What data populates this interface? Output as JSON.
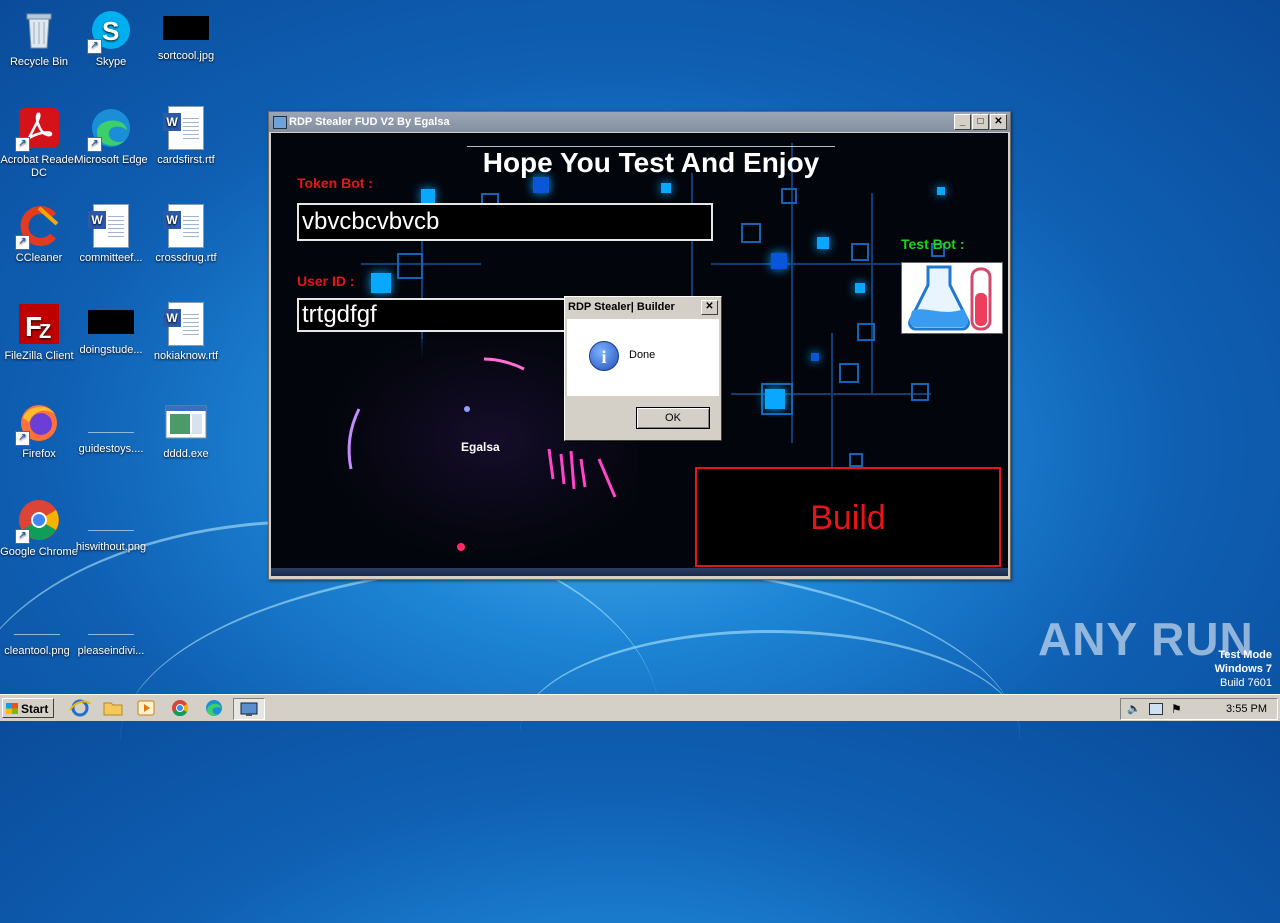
{
  "desktop": {
    "icons": [
      {
        "label": "Recycle Bin"
      },
      {
        "label": "Skype"
      },
      {
        "label": "sortcool.jpg"
      },
      {
        "label": "Acrobat Reader DC"
      },
      {
        "label": "Microsoft Edge"
      },
      {
        "label": "cardsfirst.rtf"
      },
      {
        "label": "CCleaner"
      },
      {
        "label": "committeef..."
      },
      {
        "label": "crossdrug.rtf"
      },
      {
        "label": "FileZilla Client"
      },
      {
        "label": "doingstude..."
      },
      {
        "label": "nokiaknow.rtf"
      },
      {
        "label": "Firefox"
      },
      {
        "label": "guidestoys...."
      },
      {
        "label": "dddd.exe"
      },
      {
        "label": "Google Chrome"
      },
      {
        "label": "hiswithout.png"
      },
      {
        "label": "cleantool.png"
      },
      {
        "label": "pleaseindivi..."
      }
    ]
  },
  "window": {
    "title": "RDP Stealer FUD V2 By Egalsa",
    "headline": "Hope You Test And Enjoy",
    "token_label": "Token Bot :",
    "token_value": "vbvcbcvbvcb",
    "userid_label": "User ID :",
    "userid_value": "trtgdfgf",
    "testbot_label": "Test Bot :",
    "author_text": "Egalsa",
    "build_label": "Build"
  },
  "dialog": {
    "title": "RDP Stealer| Builder",
    "message": "Done",
    "ok_label": "OK"
  },
  "taskbar": {
    "start_label": "Start",
    "clock": "3:55 PM"
  },
  "watermark": {
    "line1": "Test Mode",
    "line2": "Windows 7",
    "line3": "Build 7601",
    "brand": "ANY RUN"
  },
  "colors": {
    "accent_red": "#e8141c",
    "accent_green": "#1bd61b",
    "desktop_blue": "#1e86d6"
  }
}
